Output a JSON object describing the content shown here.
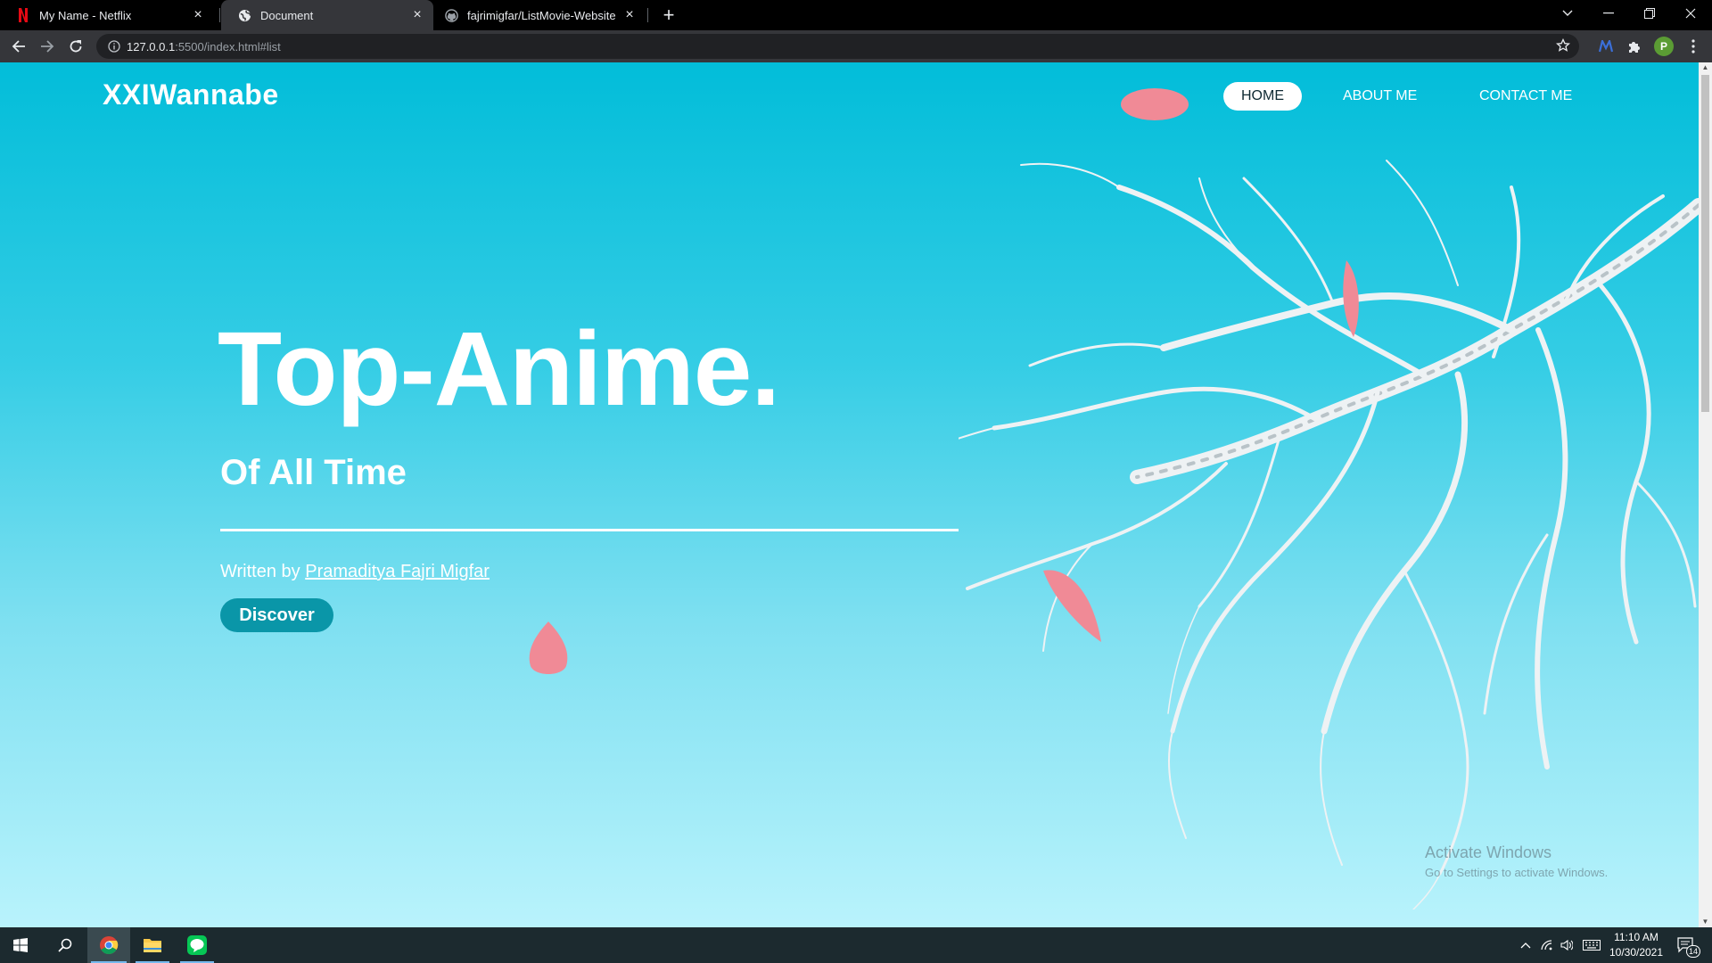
{
  "browser": {
    "tabs": [
      {
        "title": "My Name - Netflix",
        "icon": "netflix-icon",
        "active": false
      },
      {
        "title": "Document",
        "icon": "globe-icon",
        "active": true
      },
      {
        "title": "fajrimigfar/ListMovie-Website",
        "icon": "github-icon",
        "active": false
      }
    ],
    "url_host": "127.0.0.1",
    "url_rest": ":5500/index.html#list"
  },
  "page": {
    "brand": "XXIWannabe",
    "nav": [
      {
        "label": "HOME",
        "active": true
      },
      {
        "label": "ABOUT ME",
        "active": false
      },
      {
        "label": "CONTACT ME",
        "active": false
      }
    ],
    "hero_title": "Top-Anime.",
    "hero_subtitle": "Of All Time",
    "written_prefix": "Written by",
    "author": "Pramaditya Fajri Migfar",
    "discover_label": "Discover",
    "colors": {
      "accent": "#0a96a8",
      "sky_top": "#02bdd9",
      "sky_bottom": "#b9f3fc",
      "petal": "#f08a96"
    }
  },
  "watermark": {
    "title": "Activate Windows",
    "subtitle": "Go to Settings to activate Windows."
  },
  "taskbar": {
    "time": "11:10 AM",
    "date": "10/30/2021",
    "notifications": "14",
    "apps": [
      "windows-start-icon",
      "search-icon",
      "chrome-icon",
      "file-explorer-icon",
      "line-icon"
    ]
  }
}
